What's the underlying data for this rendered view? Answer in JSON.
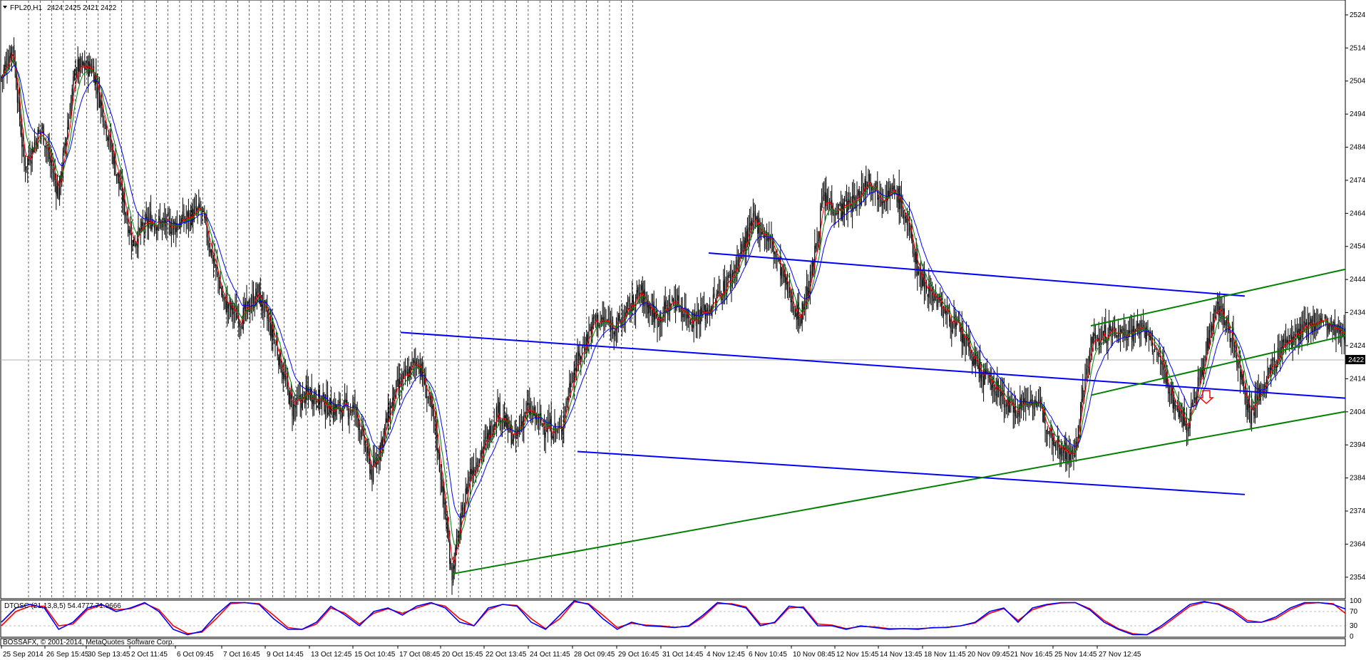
{
  "header": {
    "symbol": "FPL20,H1",
    "ohlc": "2424 2425 2421 2422"
  },
  "indicator": {
    "label": "DTOSC (21,13,8,5) 54.4777 71.9666",
    "levels": [
      100,
      70,
      30,
      0
    ]
  },
  "footer": {
    "copyright": "BOSSAFX, © 2001-2014, MetaQuotes Software Corp."
  },
  "colors": {
    "background": "#ffffff",
    "grid": "#000000",
    "candles": "#000000",
    "ma_fast": "#ff0000",
    "ma_mid": "#008000",
    "ma_slow": "#0000ff",
    "channel_blue": "#0000ff",
    "channel_green": "#008000",
    "price_tag_bg": "#000000",
    "price_tag_text": "#ffffff",
    "osc_fast": "#0000ff",
    "osc_slow": "#ff0000",
    "arrow": "#ff0000"
  },
  "icons": {
    "menu": "triangle-down-icon",
    "signal": "sell-arrow-down-icon"
  },
  "chart_data": {
    "type": "candlestick",
    "timeframe": "H1",
    "x_ticks": [
      "25 Sep 2014",
      "26 Sep 15:45",
      "30 Sep 13:45",
      "2 Oct 11:45",
      "6 Oct 09:45",
      "7 Oct 16:45",
      "9 Oct 14:45",
      "13 Oct 12:45",
      "15 Oct 10:45",
      "17 Oct 08:45",
      "20 Oct 15:45",
      "22 Oct 13:45",
      "24 Oct 11:45",
      "28 Oct 09:45",
      "29 Oct 16:45",
      "31 Oct 14:45",
      "4 Nov 12:45",
      "6 Nov 10:45",
      "10 Nov 08:45",
      "12 Nov 15:45",
      "14 Nov 13:45",
      "18 Nov 11:45",
      "20 Nov 09:45",
      "21 Nov 16:45",
      "25 Nov 14:45",
      "27 Nov 12:45"
    ],
    "y_ticks": [
      2524,
      2514,
      2504,
      2494,
      2484,
      2474,
      2464,
      2454,
      2444,
      2434,
      2424,
      2414,
      2404,
      2394,
      2384,
      2374,
      2364,
      2354
    ],
    "ylim": [
      2347.5,
      2528.5
    ],
    "last_price": 2422,
    "close_path": [
      [
        0,
        2505
      ],
      [
        10,
        2515
      ],
      [
        20,
        2478
      ],
      [
        35,
        2490
      ],
      [
        50,
        2470
      ],
      [
        65,
        2508
      ],
      [
        80,
        2508
      ],
      [
        100,
        2478
      ],
      [
        115,
        2455
      ],
      [
        130,
        2462
      ],
      [
        150,
        2460
      ],
      [
        175,
        2465
      ],
      [
        195,
        2437
      ],
      [
        210,
        2432
      ],
      [
        225,
        2440
      ],
      [
        240,
        2425
      ],
      [
        255,
        2405
      ],
      [
        270,
        2410
      ],
      [
        290,
        2405
      ],
      [
        310,
        2405
      ],
      [
        325,
        2385
      ],
      [
        345,
        2410
      ],
      [
        365,
        2420
      ],
      [
        380,
        2400
      ],
      [
        395,
        2355
      ],
      [
        410,
        2385
      ],
      [
        425,
        2395
      ],
      [
        435,
        2405
      ],
      [
        450,
        2395
      ],
      [
        460,
        2405
      ],
      [
        475,
        2400
      ],
      [
        490,
        2398
      ],
      [
        500,
        2415
      ],
      [
        520,
        2432
      ],
      [
        540,
        2430
      ],
      [
        560,
        2440
      ],
      [
        575,
        2432
      ],
      [
        590,
        2438
      ],
      [
        605,
        2432
      ],
      [
        620,
        2435
      ],
      [
        640,
        2445
      ],
      [
        660,
        2462
      ],
      [
        675,
        2455
      ],
      [
        690,
        2440
      ],
      [
        700,
        2432
      ],
      [
        710,
        2445
      ],
      [
        720,
        2468
      ],
      [
        735,
        2465
      ],
      [
        750,
        2468
      ],
      [
        760,
        2475
      ],
      [
        770,
        2470
      ],
      [
        785,
        2470
      ],
      [
        795,
        2460
      ],
      [
        805,
        2445
      ],
      [
        820,
        2438
      ],
      [
        840,
        2428
      ],
      [
        860,
        2415
      ],
      [
        875,
        2410
      ],
      [
        885,
        2405
      ],
      [
        905,
        2408
      ],
      [
        925,
        2395
      ],
      [
        940,
        2390
      ],
      [
        955,
        2425
      ],
      [
        970,
        2428
      ],
      [
        985,
        2428
      ],
      [
        1000,
        2430
      ],
      [
        1015,
        2420
      ],
      [
        1030,
        2405
      ],
      [
        1040,
        2400
      ],
      [
        1055,
        2420
      ],
      [
        1065,
        2438
      ],
      [
        1080,
        2425
      ],
      [
        1090,
        2410
      ],
      [
        1095,
        2403
      ],
      [
        1110,
        2415
      ],
      [
        1125,
        2425
      ],
      [
        1140,
        2428
      ],
      [
        1155,
        2432
      ],
      [
        1170,
        2428
      ],
      [
        1190,
        2422
      ]
    ],
    "channel_lines": [
      {
        "color": "blue",
        "points": [
          [
            620,
            2452
          ],
          [
            1090,
            2439
          ]
        ]
      },
      {
        "color": "blue",
        "points": [
          [
            350,
            2428
          ],
          [
            1225,
            2407
          ]
        ]
      },
      {
        "color": "blue",
        "points": [
          [
            505,
            2392
          ],
          [
            1090,
            2379
          ]
        ]
      },
      {
        "color": "green",
        "points": [
          [
            395,
            2355
          ],
          [
            1225,
            2407
          ]
        ]
      },
      {
        "color": "green",
        "points": [
          [
            955,
            2409
          ],
          [
            1190,
            2428
          ]
        ]
      },
      {
        "color": "green",
        "points": [
          [
            955,
            2430
          ],
          [
            1190,
            2448
          ]
        ]
      }
    ],
    "oscillator": {
      "name": "DTOSC",
      "params": "21,13,8,5",
      "values": [
        54.4777,
        71.9666
      ],
      "ylim": [
        0,
        100
      ],
      "fast": [
        [
          0,
          40
        ],
        [
          10,
          80
        ],
        [
          20,
          90
        ],
        [
          30,
          80
        ],
        [
          40,
          20
        ],
        [
          50,
          40
        ],
        [
          60,
          80
        ],
        [
          70,
          90
        ],
        [
          80,
          70
        ],
        [
          90,
          80
        ],
        [
          100,
          95
        ],
        [
          110,
          70
        ],
        [
          120,
          20
        ],
        [
          130,
          5
        ],
        [
          140,
          15
        ],
        [
          150,
          60
        ],
        [
          160,
          95
        ],
        [
          170,
          95
        ],
        [
          180,
          90
        ],
        [
          190,
          50
        ],
        [
          200,
          20
        ],
        [
          210,
          20
        ],
        [
          220,
          40
        ],
        [
          230,
          85
        ],
        [
          240,
          60
        ],
        [
          250,
          30
        ],
        [
          260,
          70
        ],
        [
          270,
          80
        ],
        [
          280,
          60
        ],
        [
          290,
          85
        ],
        [
          300,
          95
        ],
        [
          310,
          80
        ],
        [
          320,
          40
        ],
        [
          330,
          30
        ],
        [
          340,
          80
        ],
        [
          350,
          90
        ],
        [
          360,
          85
        ],
        [
          370,
          40
        ],
        [
          380,
          20
        ],
        [
          390,
          60
        ],
        [
          400,
          100
        ],
        [
          410,
          90
        ],
        [
          420,
          50
        ],
        [
          430,
          20
        ],
        [
          440,
          40
        ],
        [
          450,
          30
        ],
        [
          460,
          28
        ],
        [
          470,
          25
        ],
        [
          480,
          30
        ],
        [
          490,
          60
        ],
        [
          500,
          95
        ],
        [
          510,
          90
        ],
        [
          520,
          80
        ],
        [
          530,
          30
        ],
        [
          540,
          40
        ],
        [
          550,
          85
        ],
        [
          560,
          80
        ],
        [
          570,
          30
        ],
        [
          580,
          30
        ],
        [
          590,
          20
        ],
        [
          600,
          30
        ],
        [
          610,
          25
        ],
        [
          620,
          20
        ],
        [
          630,
          22
        ],
        [
          640,
          20
        ],
        [
          650,
          25
        ],
        [
          660,
          25
        ],
        [
          670,
          30
        ],
        [
          680,
          40
        ],
        [
          690,
          70
        ],
        [
          700,
          80
        ],
        [
          710,
          40
        ],
        [
          720,
          80
        ],
        [
          730,
          90
        ],
        [
          740,
          95
        ],
        [
          750,
          95
        ],
        [
          760,
          75
        ],
        [
          770,
          40
        ],
        [
          780,
          20
        ],
        [
          790,
          5
        ],
        [
          800,
          5
        ],
        [
          810,
          30
        ],
        [
          820,
          60
        ],
        [
          830,
          90
        ],
        [
          840,
          98
        ],
        [
          850,
          90
        ],
        [
          860,
          70
        ],
        [
          870,
          40
        ],
        [
          880,
          40
        ],
        [
          890,
          55
        ],
        [
          900,
          80
        ],
        [
          910,
          95
        ],
        [
          920,
          95
        ],
        [
          930,
          90
        ],
        [
          940,
          75
        ]
      ],
      "slow": [
        [
          0,
          30
        ],
        [
          10,
          70
        ],
        [
          20,
          85
        ],
        [
          30,
          85
        ],
        [
          40,
          30
        ],
        [
          50,
          35
        ],
        [
          60,
          75
        ],
        [
          70,
          88
        ],
        [
          80,
          75
        ],
        [
          90,
          78
        ],
        [
          100,
          93
        ],
        [
          110,
          75
        ],
        [
          120,
          30
        ],
        [
          130,
          8
        ],
        [
          140,
          12
        ],
        [
          150,
          50
        ],
        [
          160,
          92
        ],
        [
          170,
          95
        ],
        [
          180,
          92
        ],
        [
          190,
          60
        ],
        [
          200,
          25
        ],
        [
          210,
          20
        ],
        [
          220,
          35
        ],
        [
          230,
          80
        ],
        [
          240,
          65
        ],
        [
          250,
          35
        ],
        [
          260,
          65
        ],
        [
          270,
          78
        ],
        [
          280,
          65
        ],
        [
          290,
          80
        ],
        [
          300,
          93
        ],
        [
          310,
          85
        ],
        [
          320,
          50
        ],
        [
          330,
          30
        ],
        [
          340,
          75
        ],
        [
          350,
          90
        ],
        [
          360,
          87
        ],
        [
          370,
          50
        ],
        [
          380,
          22
        ],
        [
          390,
          50
        ],
        [
          400,
          97
        ],
        [
          410,
          92
        ],
        [
          420,
          60
        ],
        [
          430,
          25
        ],
        [
          440,
          37
        ],
        [
          450,
          32
        ],
        [
          460,
          30
        ],
        [
          470,
          26
        ],
        [
          480,
          28
        ],
        [
          490,
          55
        ],
        [
          500,
          92
        ],
        [
          510,
          92
        ],
        [
          520,
          83
        ],
        [
          530,
          35
        ],
        [
          540,
          38
        ],
        [
          550,
          80
        ],
        [
          560,
          83
        ],
        [
          570,
          35
        ],
        [
          580,
          32
        ],
        [
          590,
          22
        ],
        [
          600,
          28
        ],
        [
          610,
          27
        ],
        [
          620,
          22
        ],
        [
          630,
          22
        ],
        [
          640,
          22
        ],
        [
          650,
          24
        ],
        [
          660,
          26
        ],
        [
          670,
          30
        ],
        [
          680,
          38
        ],
        [
          690,
          65
        ],
        [
          700,
          78
        ],
        [
          710,
          45
        ],
        [
          720,
          75
        ],
        [
          730,
          88
        ],
        [
          740,
          94
        ],
        [
          750,
          95
        ],
        [
          760,
          78
        ],
        [
          770,
          45
        ],
        [
          780,
          22
        ],
        [
          790,
          8
        ],
        [
          800,
          5
        ],
        [
          810,
          25
        ],
        [
          820,
          55
        ],
        [
          830,
          85
        ],
        [
          840,
          96
        ],
        [
          850,
          92
        ],
        [
          860,
          75
        ],
        [
          870,
          45
        ],
        [
          880,
          40
        ],
        [
          890,
          50
        ],
        [
          900,
          75
        ],
        [
          910,
          92
        ],
        [
          920,
          95
        ],
        [
          930,
          92
        ],
        [
          940,
          60
        ]
      ]
    }
  }
}
